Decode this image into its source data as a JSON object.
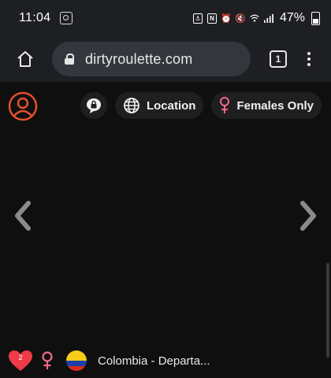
{
  "status_bar": {
    "time": "11:04",
    "battery": "47%",
    "icons": [
      "screen-record-icon",
      "nfc-icon",
      "n-icon",
      "alarm-icon",
      "mute-icon",
      "wifi-icon",
      "signal-icon",
      "battery-icon"
    ]
  },
  "browser": {
    "url": "dirtyroulette.com",
    "tab_count": "1"
  },
  "page": {
    "location_filter": "Location",
    "gender_filter": "Females Only",
    "heart_count": "2",
    "partner_location": "Colombia - Departa..."
  },
  "colors": {
    "accent_red": "#e5502c",
    "female_pink": "#f06a8a",
    "heart_red": "#ee3b46"
  }
}
